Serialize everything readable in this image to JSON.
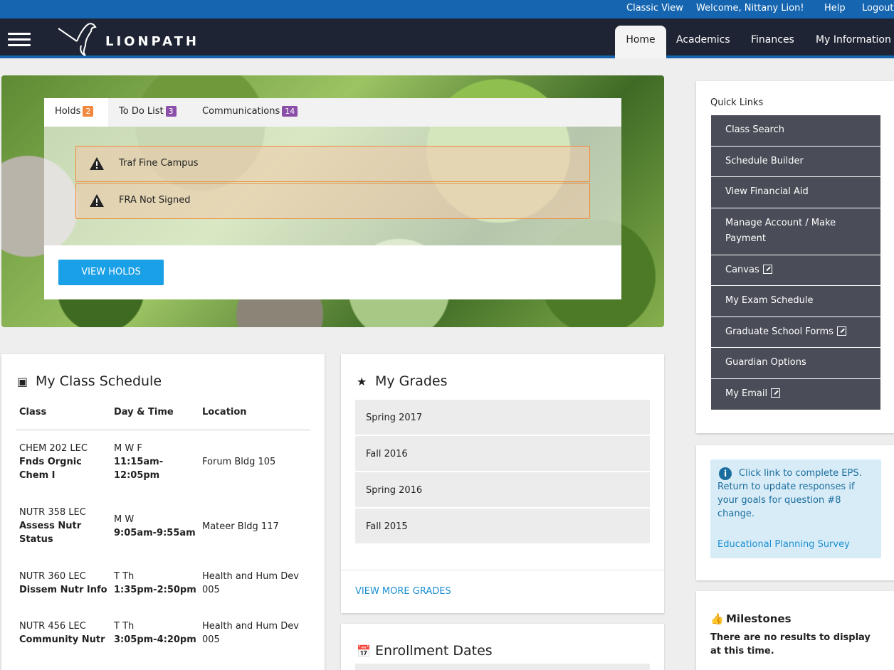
{
  "topbar": {
    "classic_view": "Classic View",
    "welcome": "Welcome, Nittany Lion!",
    "help": "Help",
    "logout": "Logout"
  },
  "brand": {
    "name": "LIONPATH"
  },
  "nav": {
    "tabs": [
      {
        "label": "Home",
        "active": true
      },
      {
        "label": "Academics"
      },
      {
        "label": "Finances"
      },
      {
        "label": "My Information"
      }
    ]
  },
  "holds_panel": {
    "tabs": [
      {
        "label": "Holds",
        "count": "2",
        "color": "#f0883e"
      },
      {
        "label": "To Do List",
        "count": "3",
        "color": "#8a4fa8"
      },
      {
        "label": "Communications",
        "count": "14",
        "color": "#8a4fa8"
      }
    ],
    "items": [
      "Traf Fine Campus",
      "FRA Not Signed"
    ],
    "button": "VIEW HOLDS"
  },
  "schedule": {
    "title": "My Class Schedule",
    "columns": [
      "Class",
      "Day & Time",
      "Location"
    ],
    "rows": [
      {
        "code": "CHEM  202 LEC",
        "name": "Fnds Orgnic Chem I",
        "days": "M W F",
        "time": "11:15am-12:05pm",
        "location": "Forum Bldg 105"
      },
      {
        "code": "NUTR  358 LEC",
        "name": "Assess Nutr Status",
        "days": "M W",
        "time": "9:05am-9:55am",
        "location": "Mateer Bldg 117"
      },
      {
        "code": "NUTR  360 LEC",
        "name": "Dissem Nutr Info",
        "days": "T Th",
        "time": "1:35pm-2:50pm",
        "location": "Health and Hum Dev 005"
      },
      {
        "code": "NUTR  456 LEC",
        "name": "Community Nutr",
        "days": "T Th",
        "time": "3:05pm-4:20pm",
        "location": "Health and Hum Dev 005"
      }
    ]
  },
  "grades": {
    "title": "My Grades",
    "terms": [
      "Spring 2017",
      "Fall 2016",
      "Spring 2016",
      "Fall 2015"
    ],
    "more_link": "VIEW MORE GRADES"
  },
  "enrollment": {
    "title": "Enrollment Dates"
  },
  "quick_links": {
    "title": "Quick Links",
    "items": [
      {
        "label": "Class Search",
        "external": false
      },
      {
        "label": "Schedule Builder",
        "external": false
      },
      {
        "label": "View Financial Aid",
        "external": false
      },
      {
        "label": "Manage Account / Make Payment",
        "external": false
      },
      {
        "label": "Canvas",
        "external": true
      },
      {
        "label": "My Exam Schedule",
        "external": false
      },
      {
        "label": "Graduate School Forms",
        "external": true
      },
      {
        "label": "Guardian Options",
        "external": false
      },
      {
        "label": "My Email",
        "external": true
      }
    ]
  },
  "eps": {
    "message": "Click link to complete EPS. Return to update responses if your goals for question #8 change.",
    "link": "Educational Planning Survey"
  },
  "milestones": {
    "title": "Milestones",
    "empty": "There are no results to display at this time."
  }
}
